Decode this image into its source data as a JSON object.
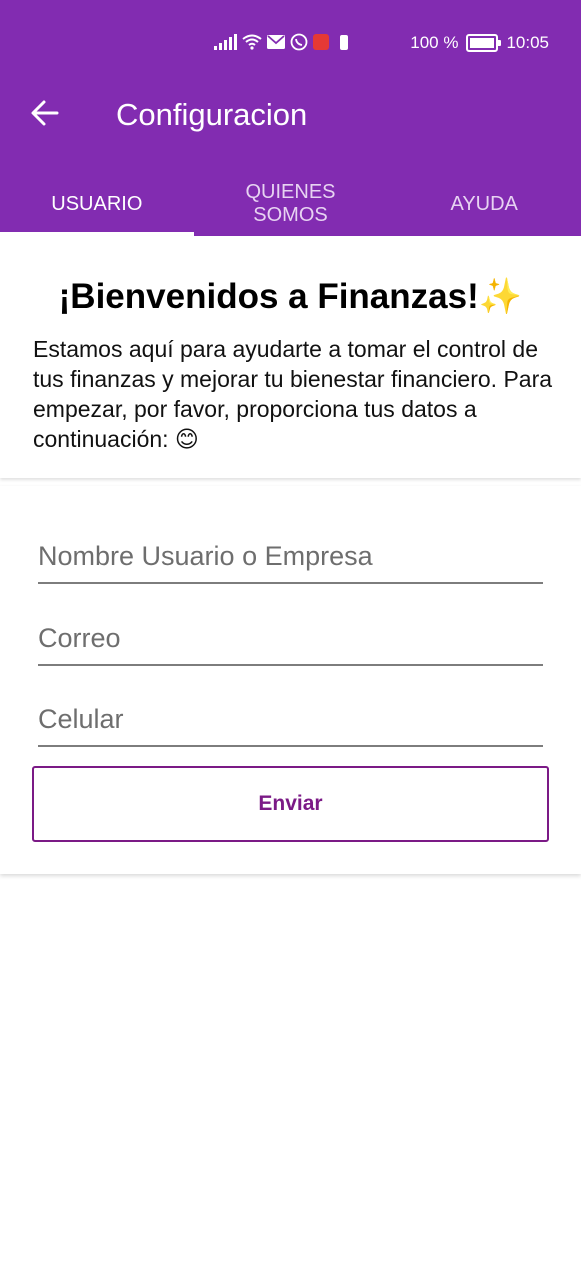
{
  "status_bar": {
    "battery_text": "100 %",
    "time": "10:05"
  },
  "toolbar": {
    "title": "Configuracion",
    "back_icon": "arrow-left-icon"
  },
  "tabs": [
    {
      "label": "USUARIO",
      "active": true
    },
    {
      "label": "QUIENES SOMOS",
      "active": false
    },
    {
      "label": "AYUDA",
      "active": false
    }
  ],
  "welcome": {
    "heading": "¡Bienvenidos a Finanzas!✨",
    "body": "Estamos aquí para ayudarte a tomar el control de tus finanzas y mejorar tu bienestar financiero. Para empezar, por favor, proporciona tus datos a continuación: 😊"
  },
  "form": {
    "name_placeholder": "Nombre Usuario o Empresa",
    "email_placeholder": "Correo",
    "phone_placeholder": "Celular",
    "submit_label": "Enviar"
  },
  "colors": {
    "primary": "#822cb1",
    "accent": "#7b1a86"
  }
}
